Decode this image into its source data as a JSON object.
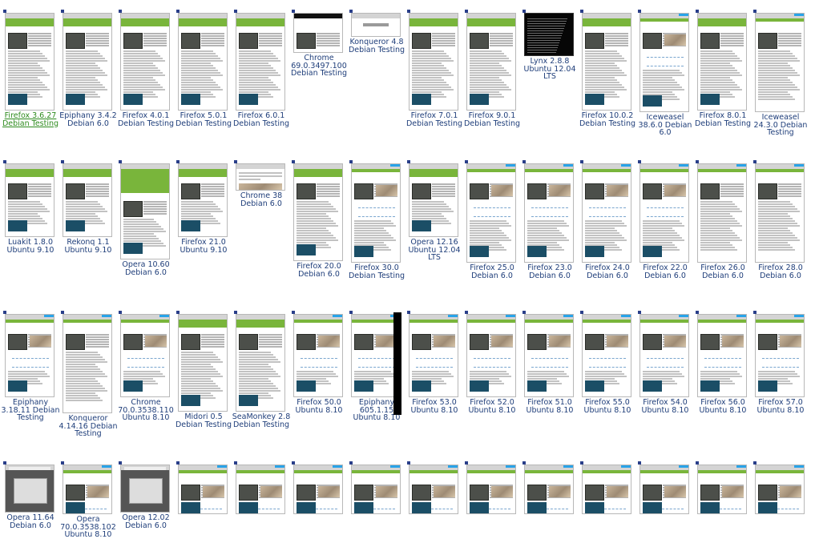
{
  "gallery": {
    "thumbnails": [
      {
        "caption": [
          "Firefox 3.6.27",
          "Debian Testing"
        ],
        "style": "classic",
        "selected": true
      },
      {
        "caption": [
          "Epiphany 3.4.2",
          "Debian 6.0"
        ],
        "style": "classic"
      },
      {
        "caption": [
          "Firefox 4.0.1",
          "Debian Testing"
        ],
        "style": "classic"
      },
      {
        "caption": [
          "Firefox 5.0.1",
          "Debian Testing"
        ],
        "style": "classic"
      },
      {
        "caption": [
          "Firefox 6.0.1",
          "Debian Testing"
        ],
        "style": "classic"
      },
      {
        "caption": [
          "Chrome",
          "69.0.3497.100",
          "Debian Testing"
        ],
        "style": "short-dark"
      },
      {
        "caption": [
          "Konqueror 4.8",
          "Debian Testing"
        ],
        "style": "tiny"
      },
      {
        "caption": [
          "Firefox 7.0.1",
          "Debian Testing"
        ],
        "style": "classic"
      },
      {
        "caption": [
          "Firefox 9.0.1",
          "Debian Testing"
        ],
        "style": "classic"
      },
      {
        "caption": [
          "Lynx 2.8.8",
          "Ubuntu 12.04",
          "LTS"
        ],
        "style": "terminal"
      },
      {
        "caption": [
          "Firefox 10.0.2",
          "Debian Testing"
        ],
        "style": "classic"
      },
      {
        "caption": [
          "Iceweasel",
          "38.6.0 Debian",
          "6.0"
        ],
        "style": "modern"
      },
      {
        "caption": [
          "Firefox 8.0.1",
          "Debian Testing"
        ],
        "style": "classic"
      },
      {
        "caption": [
          "Iceweasel",
          "24.3.0 Debian",
          "Testing"
        ],
        "style": "modern-plain"
      },
      {
        "caption": [
          "Luakit 1.8.0",
          "Ubuntu 9.10"
        ],
        "style": "classic-short"
      },
      {
        "caption": [
          "Rekonq 1.1",
          "Ubuntu 9.10"
        ],
        "style": "classic-short"
      },
      {
        "caption": [
          "Opera 10.60",
          "Debian 6.0"
        ],
        "style": "opera"
      },
      {
        "caption": [
          "Firefox 21.0",
          "Ubuntu 9.10"
        ],
        "style": "classic-short"
      },
      {
        "caption": [
          "Chrome 38",
          "Debian 6.0"
        ],
        "style": "mini"
      },
      {
        "caption": [
          "Firefox 20.0",
          "Debian 6.0"
        ],
        "style": "classic"
      },
      {
        "caption": [
          "Firefox 30.0",
          "Debian Testing"
        ],
        "style": "modern"
      },
      {
        "caption": [
          "Opera 12.16",
          "Ubuntu 12.04",
          "LTS"
        ],
        "style": "classic-short"
      },
      {
        "caption": [
          "Firefox 25.0",
          "Debian 6.0"
        ],
        "style": "modern"
      },
      {
        "caption": [
          "Firefox 23.0",
          "Debian 6.0"
        ],
        "style": "modern"
      },
      {
        "caption": [
          "Firefox 24.0",
          "Debian 6.0"
        ],
        "style": "modern"
      },
      {
        "caption": [
          "Firefox 22.0",
          "Debian 6.0"
        ],
        "style": "modern"
      },
      {
        "caption": [
          "Firefox 26.0",
          "Debian 6.0"
        ],
        "style": "modern-plain"
      },
      {
        "caption": [
          "Firefox 28.0",
          "Debian 6.0"
        ],
        "style": "modern-plain"
      },
      {
        "caption": [
          "Epiphany",
          "3.18.11 Debian",
          "Testing"
        ],
        "style": "modern-short"
      },
      {
        "caption": [
          "Konqueror",
          "4.14.16 Debian",
          "Testing"
        ],
        "style": "modern-plain"
      },
      {
        "caption": [
          "Chrome",
          "70.0.3538.110",
          "Ubuntu 8.10"
        ],
        "style": "modern-short"
      },
      {
        "caption": [
          "Midori 0.5",
          "Debian Testing"
        ],
        "style": "classic"
      },
      {
        "caption": [
          "SeaMonkey 2.8",
          "Debian Testing"
        ],
        "style": "classic"
      },
      {
        "caption": [
          "Firefox 50.0",
          "Ubuntu 8.10"
        ],
        "style": "modern-short"
      },
      {
        "caption": [
          "Epiphany",
          "605.1.15",
          "Ubuntu 8.10"
        ],
        "style": "modern-short"
      },
      {
        "caption": [
          "Firefox 53.0",
          "Ubuntu 8.10"
        ],
        "style": "modern-short"
      },
      {
        "caption": [
          "Firefox 52.0",
          "Ubuntu 8.10"
        ],
        "style": "modern-short"
      },
      {
        "caption": [
          "Firefox 51.0",
          "Ubuntu 8.10"
        ],
        "style": "modern-short"
      },
      {
        "caption": [
          "Firefox 55.0",
          "Ubuntu 8.10"
        ],
        "style": "modern-short"
      },
      {
        "caption": [
          "Firefox 54.0",
          "Ubuntu 8.10"
        ],
        "style": "modern-short"
      },
      {
        "caption": [
          "Firefox 56.0",
          "Ubuntu 8.10"
        ],
        "style": "modern-short"
      },
      {
        "caption": [
          "Firefox 57.0",
          "Ubuntu 8.10"
        ],
        "style": "modern-short"
      },
      {
        "caption": [
          "Opera 11.64",
          "Debian 6.0"
        ],
        "style": "gray"
      },
      {
        "caption": [
          "Opera",
          "70.0.3538.102",
          "Ubuntu 8.10"
        ],
        "style": "modern-short"
      },
      {
        "caption": [
          "Opera 12.02",
          "Debian 6.0"
        ],
        "style": "gray"
      },
      {
        "caption": [],
        "style": "modern-short"
      },
      {
        "caption": [],
        "style": "modern-short"
      },
      {
        "caption": [],
        "style": "modern-short"
      },
      {
        "caption": [],
        "style": "modern-short"
      },
      {
        "caption": [],
        "style": "modern-short"
      },
      {
        "caption": [],
        "style": "modern-short"
      },
      {
        "caption": [],
        "style": "modern-short"
      },
      {
        "caption": [],
        "style": "modern-short"
      },
      {
        "caption": [],
        "style": "modern-short"
      },
      {
        "caption": [],
        "style": "modern-short"
      },
      {
        "caption": [],
        "style": "modern-short"
      }
    ]
  },
  "colors": {
    "caption": "#1f3e7a",
    "selected_caption": "#2e8b1e",
    "site_green": "#79b53b",
    "marker": "#2a3f8a"
  }
}
